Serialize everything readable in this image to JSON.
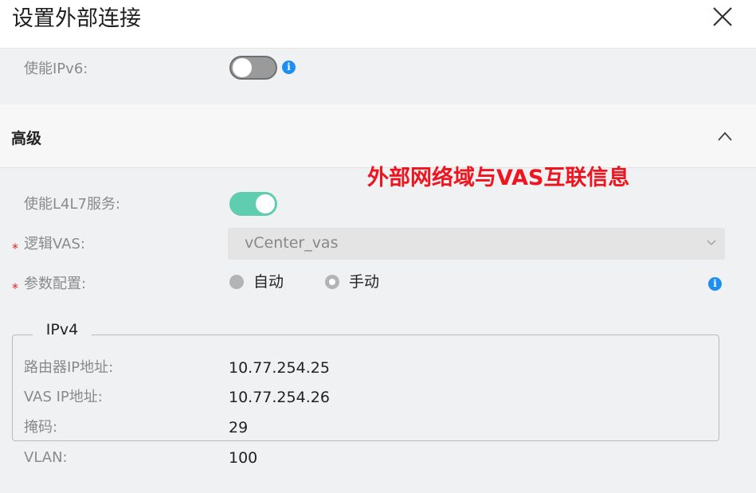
{
  "dialog": {
    "title": "设置外部连接",
    "close_icon": "close-icon"
  },
  "ipv6": {
    "label": "使能IPv6:",
    "enabled": false
  },
  "advanced": {
    "title": "高级",
    "expanded": true,
    "annotation": "外部网络域与VAS互联信息",
    "l4l7": {
      "label": "使能L4L7服务:",
      "enabled": true
    },
    "logical_vas": {
      "required_mark": "*",
      "label": "逻辑VAS:",
      "value": "vCenter_vas"
    },
    "param_config": {
      "required_mark": "*",
      "label": "参数配置:",
      "options": [
        "自动",
        "手动"
      ],
      "selected": "手动"
    },
    "ipv4": {
      "legend": "IPv4",
      "router_ip_label": "路由器IP地址:",
      "router_ip": "10.77.254.25",
      "vas_ip_label": "VAS IP地址:",
      "vas_ip": "10.77.254.26",
      "mask_label": "掩码:",
      "mask": "29"
    },
    "vlan": {
      "label": "VLAN:",
      "value": "100"
    }
  },
  "colors": {
    "toggle_on": "#5ecdb0",
    "toggle_off": "#9a9a9a",
    "info": "#1e8ff0",
    "annotation": "#f0141e",
    "required": "#e02020"
  }
}
